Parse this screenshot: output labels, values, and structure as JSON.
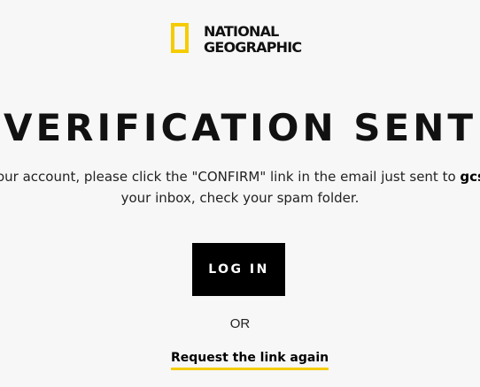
{
  "brand": {
    "logo_line1": "NATIONAL",
    "logo_line2": "GEOGRAPHIC",
    "accent_color": "#f5cc00"
  },
  "title": "VERIFICATION SENT",
  "message": {
    "line1_visible": "our account, please click the \"CONFIRM\" link in the email just sent to ",
    "email_visible": "gcs",
    "line2_visible": "your inbox, check your spam folder."
  },
  "actions": {
    "login_label": "LOG IN",
    "or_label": "OR",
    "request_link_label": "Request the link again"
  }
}
